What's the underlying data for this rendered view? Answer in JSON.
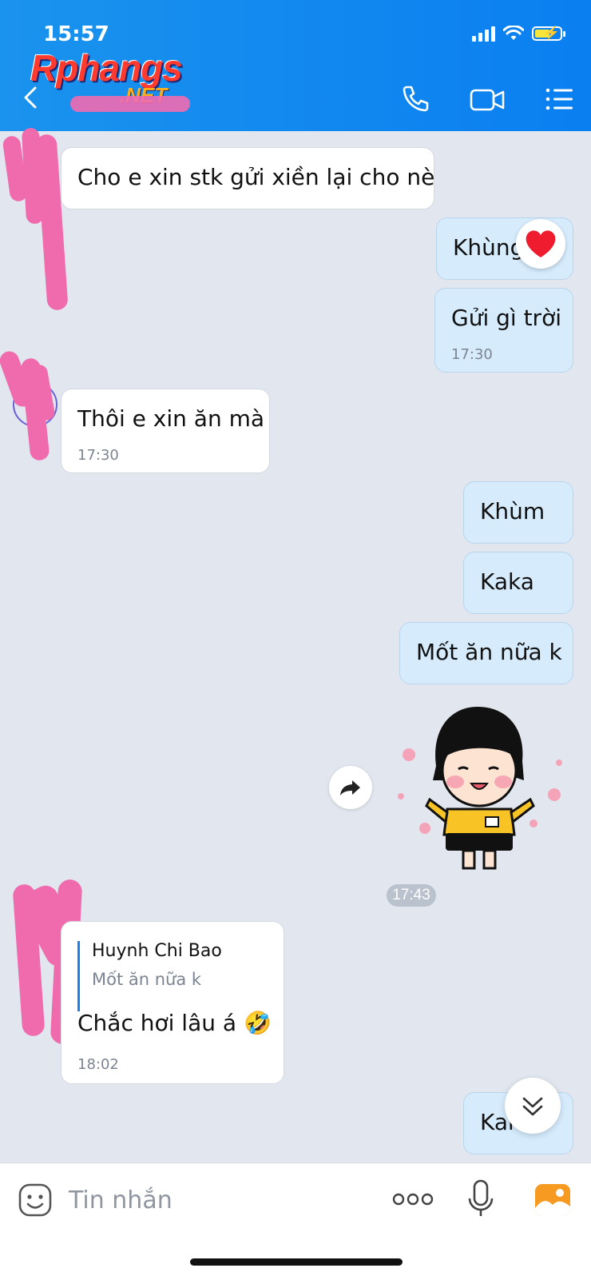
{
  "status_bar": {
    "time": "15:57"
  },
  "watermark": {
    "brand": "Rphangs",
    "tld": ".NET"
  },
  "header": {
    "back_icon": "chevron-left-icon",
    "call_icon": "phone-icon",
    "video_icon": "video-camera-icon",
    "menu_icon": "list-menu-icon"
  },
  "messages": [
    {
      "side": "in",
      "text": "Cho e xin stk gửi xiền lại cho nè"
    },
    {
      "side": "out",
      "text": "Khùng",
      "reaction": "❤️"
    },
    {
      "side": "out",
      "text": "Gửi gì trời",
      "time": "17:30"
    },
    {
      "side": "in",
      "text": "Thôi e xin ăn mà",
      "time": "17:30"
    },
    {
      "side": "out",
      "text": "Khùm"
    },
    {
      "side": "out",
      "text": "Kaka"
    },
    {
      "side": "out",
      "text": "Mốt ăn nữa k"
    },
    {
      "side": "out",
      "type": "sticker",
      "sticker": "girl-black-bob-hair-yellow-shirt-sticker"
    },
    {
      "side": "in",
      "text": "Chắc hơi lâu á 🤣",
      "time": "18:02",
      "quote": {
        "author": "Huynh Chi Bao",
        "text": "Mốt ăn nữa k"
      }
    },
    {
      "side": "out",
      "text": "Kaka"
    }
  ],
  "time_chip": "17:43",
  "composer": {
    "placeholder": "Tin nhắn",
    "value": ""
  },
  "colors": {
    "header": "#0a7ff0",
    "outgoing_bubble": "#d6ecfd",
    "incoming_bubble": "#ffffff",
    "background": "#e2e7ef",
    "redaction_pink": "#f06aae"
  }
}
